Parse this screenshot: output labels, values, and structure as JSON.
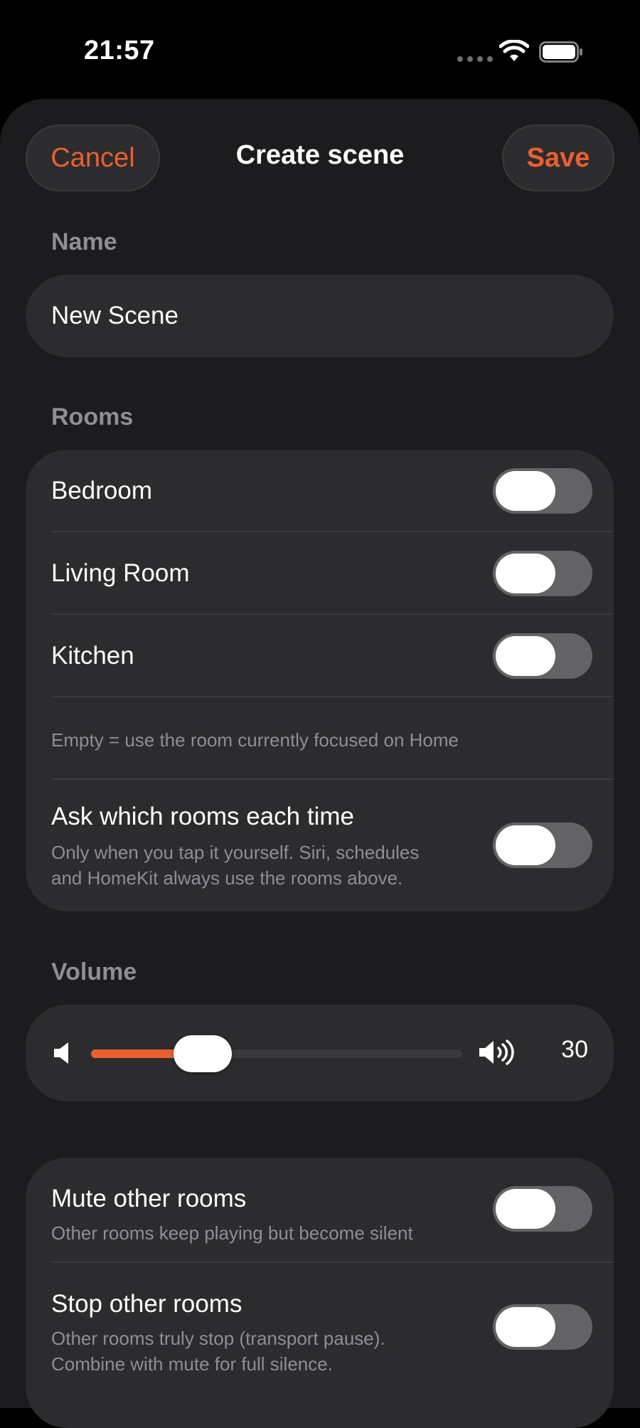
{
  "status_bar": {
    "time": "21:57"
  },
  "header": {
    "cancel_label": "Cancel",
    "title": "Create scene",
    "save_label": "Save"
  },
  "name_section": {
    "label": "Name",
    "value": "New Scene"
  },
  "rooms_section": {
    "label": "Rooms",
    "rooms": [
      {
        "label": "Bedroom",
        "on": false
      },
      {
        "label": "Living Room",
        "on": false
      },
      {
        "label": "Kitchen",
        "on": false
      }
    ],
    "hint": "Empty = use the room currently focused on Home",
    "ask_each_time": {
      "label": "Ask which rooms each time",
      "sub_line1": "Only when you tap it yourself. Siri, schedules",
      "sub_line2": "and HomeKit always use the rooms above.",
      "on": false
    }
  },
  "volume_section": {
    "label": "Volume",
    "value": "30",
    "level_percent": 30
  },
  "other_rooms": {
    "mute": {
      "label": "Mute other rooms",
      "sub": "Other rooms keep playing but become silent",
      "on": false
    },
    "stop": {
      "label": "Stop other rooms",
      "sub_line1": "Other rooms truly stop (transport pause).",
      "sub_line2": "Combine with mute for full silence.",
      "on": false
    }
  },
  "colors": {
    "accent": "#eb5f2f",
    "background": "#1c1c1e",
    "card": "#2c2c2e",
    "toggle_off": "#636366",
    "secondary_text": "#8e8e93"
  }
}
